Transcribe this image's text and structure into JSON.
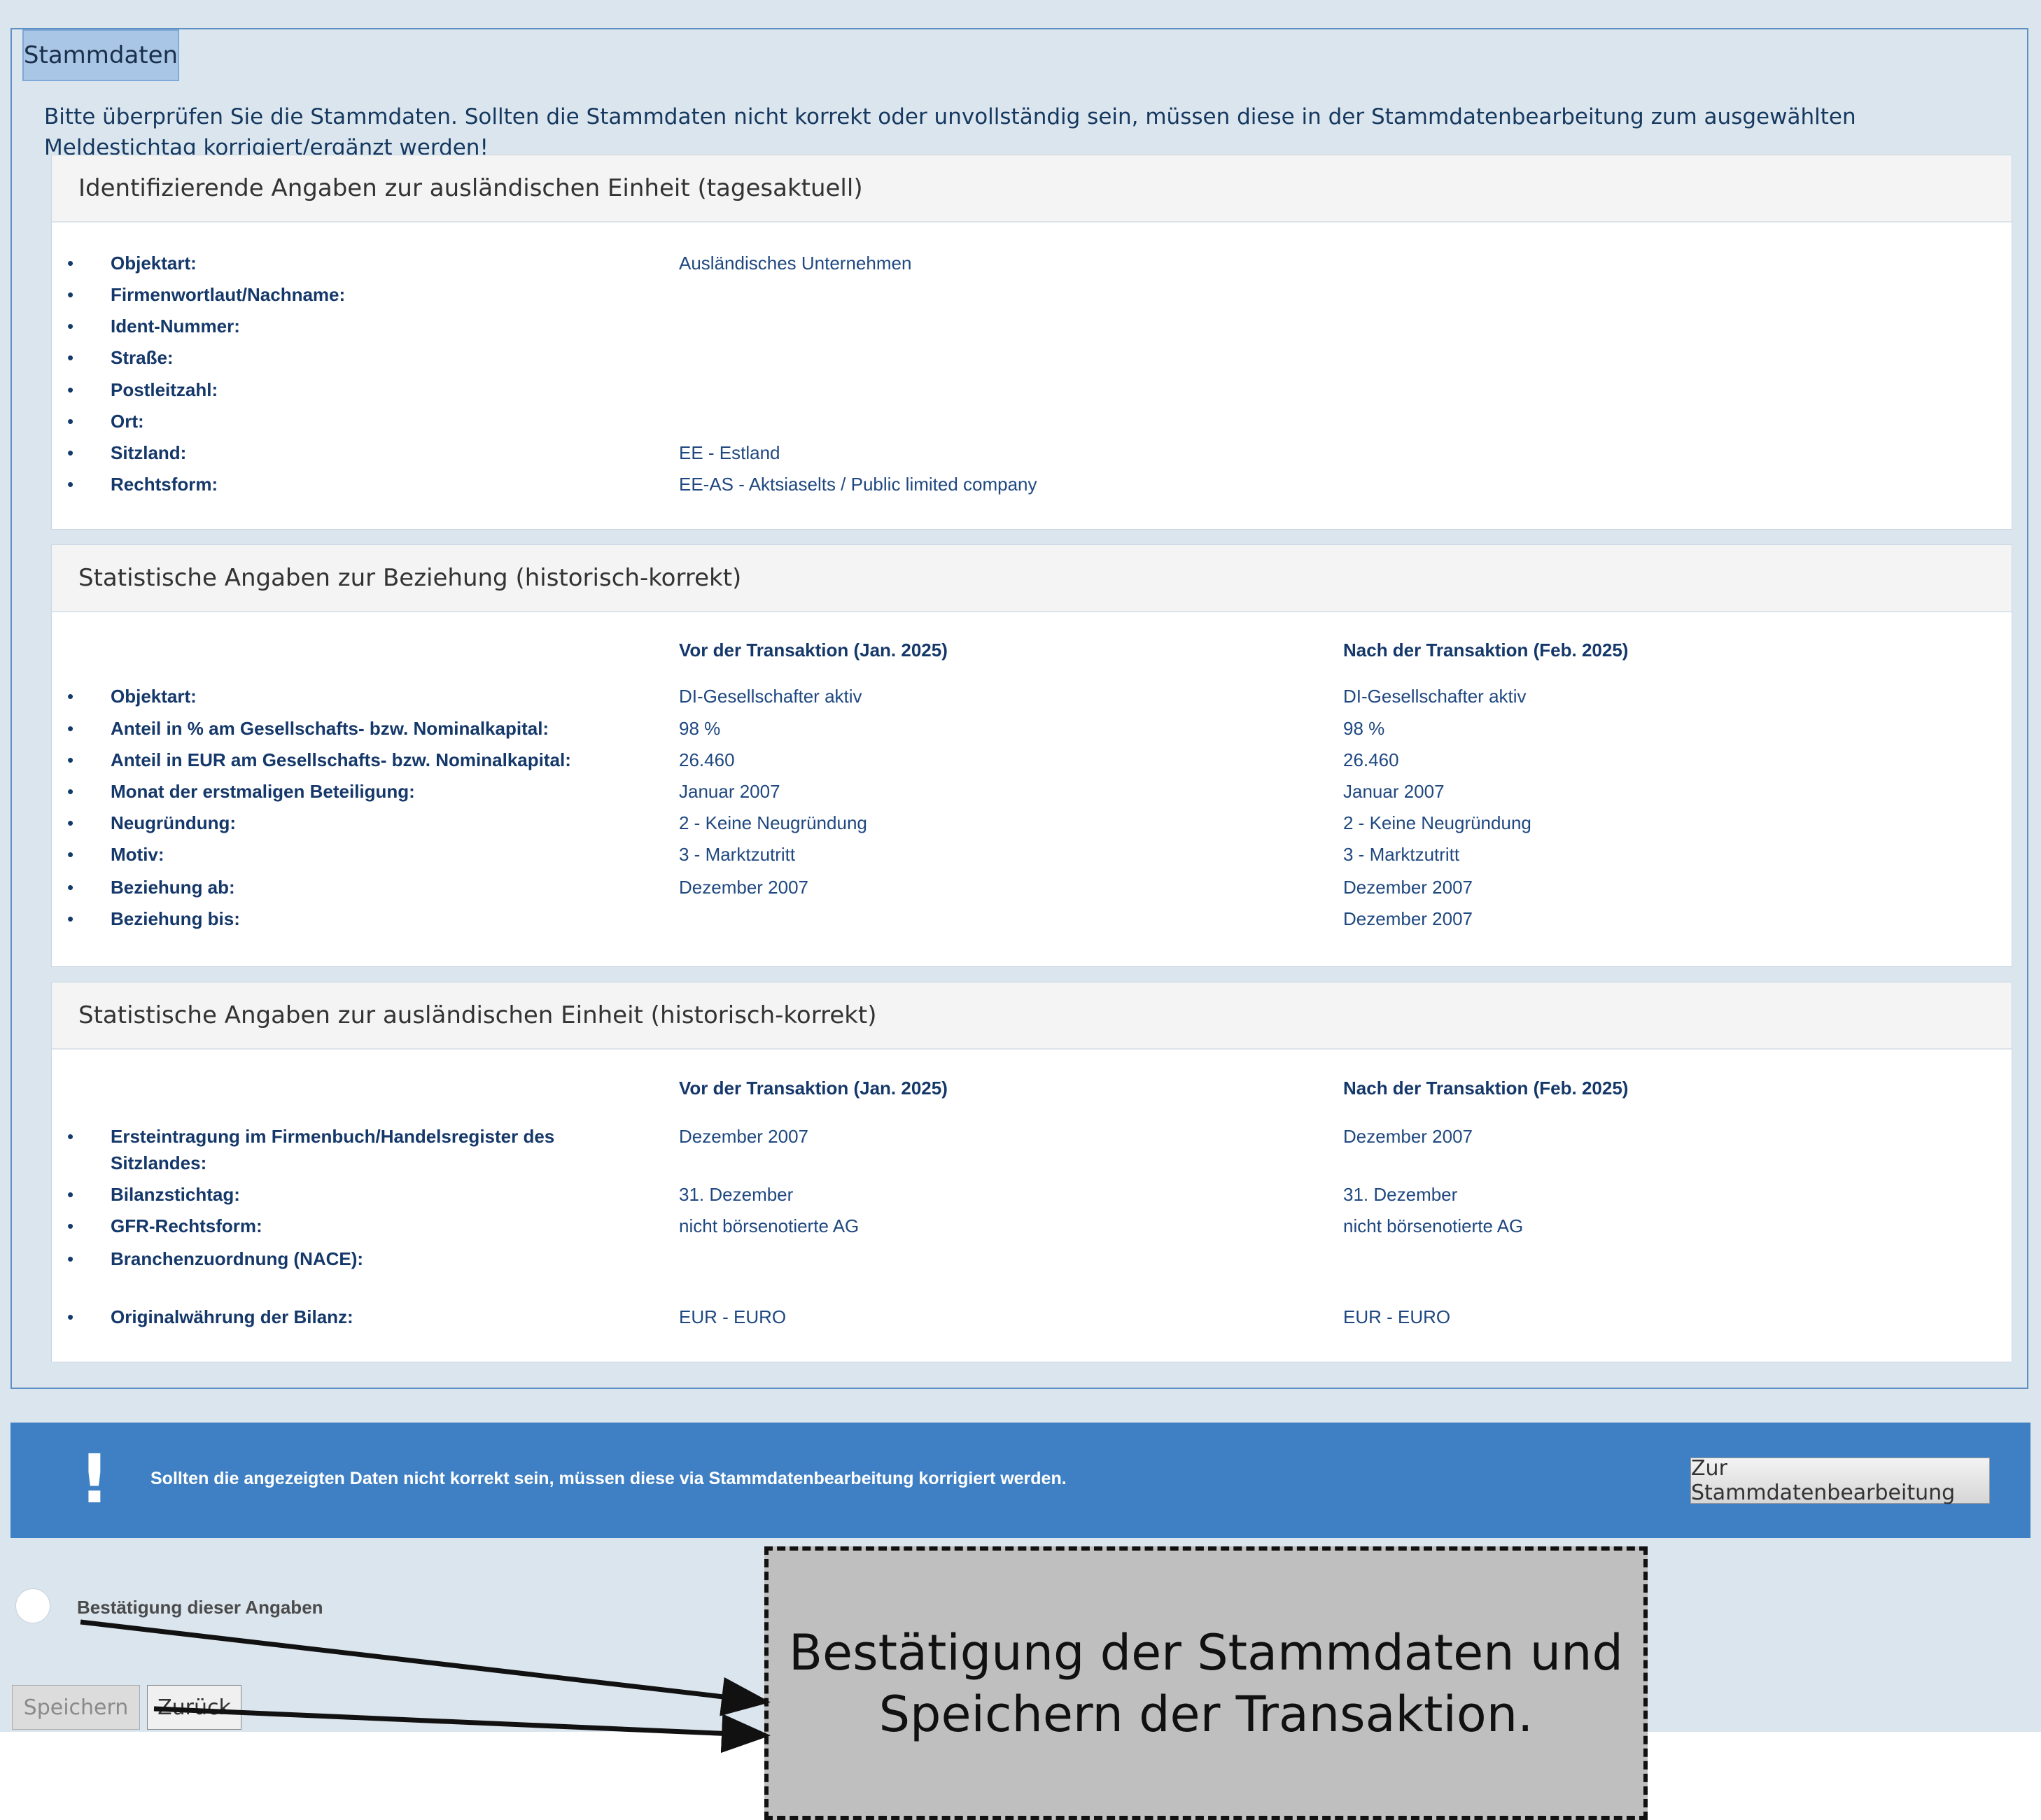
{
  "fieldset": {
    "legend": "Stammdaten",
    "intro": "Bitte überprüfen Sie die Stammdaten. Sollten die Stammdaten nicht korrekt oder unvollständig sein, müssen diese in der Stammdatenbearbeitung zum ausgewählten Meldestichtag korrigiert/ergänzt werden!"
  },
  "panel1": {
    "title": "Identifizierende Angaben zur ausländischen Einheit (tagesaktuell)",
    "rows": [
      {
        "label": "Objektart:",
        "value": "Ausländisches Unternehmen"
      },
      {
        "label": "Firmenwortlaut/Nachname:",
        "value": ""
      },
      {
        "label": "Ident-Nummer:",
        "value": ""
      },
      {
        "label": "Straße:",
        "value": ""
      },
      {
        "label": "Postleitzahl:",
        "value": ""
      },
      {
        "label": "Ort:",
        "value": ""
      },
      {
        "label": "Sitzland:",
        "value": "EE - Estland"
      },
      {
        "label": "Rechtsform:",
        "value": "EE-AS - Aktsiaselts / Public limited company"
      }
    ]
  },
  "panel2": {
    "title": "Statistische Angaben zur Beziehung (historisch-korrekt)",
    "col_before": "Vor der Transaktion (Jan. 2025)",
    "col_after": "Nach der Transaktion (Feb. 2025)",
    "rows": [
      {
        "label": "Objektart:",
        "before": "DI-Gesellschafter aktiv",
        "after": "DI-Gesellschafter aktiv"
      },
      {
        "label": "Anteil in % am Gesellschafts- bzw. Nominalkapital:",
        "before": "98 %",
        "after": "98 %"
      },
      {
        "label": "Anteil in EUR am Gesellschafts- bzw. Nominalkapital:",
        "before": "26.460",
        "after": "26.460"
      },
      {
        "label": "Monat der erstmaligen Beteiligung:",
        "before": "Januar 2007",
        "after": "Januar 2007"
      },
      {
        "label": "Neugründung:",
        "before": "2 - Keine Neugründung",
        "after": "2 - Keine Neugründung"
      },
      {
        "label": "Motiv:",
        "before": "3 - Marktzutritt",
        "after": "3 - Marktzutritt"
      },
      {
        "label": "Beziehung ab:",
        "before": "Dezember 2007",
        "after": "Dezember 2007"
      },
      {
        "label": "Beziehung bis:",
        "before": "",
        "after": "Dezember 2007"
      }
    ]
  },
  "panel3": {
    "title": "Statistische Angaben zur ausländischen Einheit (historisch-korrekt)",
    "col_before": "Vor der Transaktion (Jan. 2025)",
    "col_after": "Nach der Transaktion (Feb. 2025)",
    "rows": [
      {
        "label": "Ersteintragung im Firmenbuch/Handelsregister des",
        "label2": "Sitzlandes:",
        "before": "Dezember 2007",
        "after": "Dezember 2007"
      },
      {
        "label": "Bilanzstichtag:",
        "before": "31. Dezember",
        "after": "31. Dezember"
      },
      {
        "label": "GFR-Rechtsform:",
        "before": "nicht börsenotierte AG",
        "after": "nicht börsenotierte AG"
      },
      {
        "label": "Branchenzuordnung (NACE):",
        "before": "",
        "after": ""
      },
      {
        "label": "Originalwährung der Bilanz:",
        "before": "EUR - EURO",
        "after": "EUR - EURO"
      }
    ]
  },
  "infobar": {
    "icon": "!",
    "text": "Sollten die angezeigten Daten nicht korrekt sein, müssen diese via Stammdatenbearbeitung korrigiert werden.",
    "button": "Zur Stammdatenbearbeitung",
    "color": "#3f80c4"
  },
  "confirmation": {
    "label": "Bestätigung dieser Angaben",
    "checked": false
  },
  "buttons": {
    "save": "Speichern",
    "back": "Zurück"
  },
  "annotation": {
    "line1": "Bestätigung der Stammdaten und",
    "line2": "Speichern der Transaktion."
  }
}
